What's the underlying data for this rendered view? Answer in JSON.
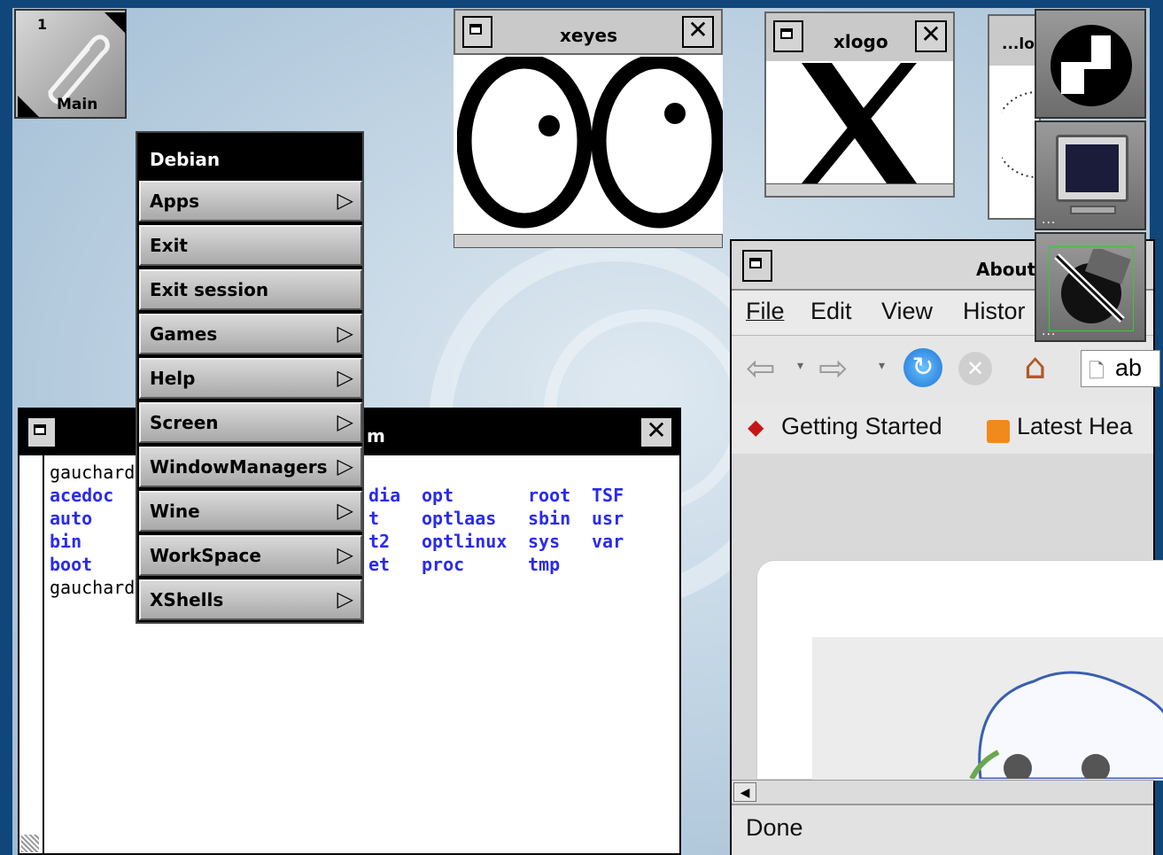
{
  "workspace": {
    "number": "1",
    "label": "Main"
  },
  "menu": {
    "title": "Debian",
    "items": [
      {
        "label": "Apps",
        "submenu": true
      },
      {
        "label": "Exit",
        "submenu": false
      },
      {
        "label": "Exit session",
        "submenu": false
      },
      {
        "label": "Games",
        "submenu": true
      },
      {
        "label": "Help",
        "submenu": true
      },
      {
        "label": "Screen",
        "submenu": true
      },
      {
        "label": "WindowManagers",
        "submenu": true
      },
      {
        "label": "Wine",
        "submenu": true
      },
      {
        "label": "WorkSpace",
        "submenu": true
      },
      {
        "label": "XShells",
        "submenu": true
      }
    ]
  },
  "xeyes": {
    "title": "xeyes"
  },
  "xlogo": {
    "title": "xlogo"
  },
  "xclock": {
    "title": "...lo"
  },
  "terminal": {
    "title_fragment": "m",
    "prompt1": "gauchard(",
    "prompt2": "gauchard(",
    "listing_left": [
      "acedoc",
      "auto",
      "bin",
      "boot"
    ],
    "listing_mid": [
      "dia",
      "t",
      "t2",
      "et"
    ],
    "listing_c1": [
      "opt",
      "optlaas",
      "optlinux",
      "proc"
    ],
    "listing_c2": [
      "root",
      "sbin",
      "sys",
      "tmp"
    ],
    "listing_c3": [
      "TSF",
      "usr",
      "var",
      ""
    ]
  },
  "firefox": {
    "title": "About",
    "menu": [
      "File",
      "Edit",
      "View",
      "Histor"
    ],
    "address": "ab",
    "bookmarks": [
      "Getting Started",
      "Latest Hea"
    ],
    "status": "Done"
  },
  "colors": {
    "desktop": "#10467a",
    "link": "#2a2af0"
  }
}
